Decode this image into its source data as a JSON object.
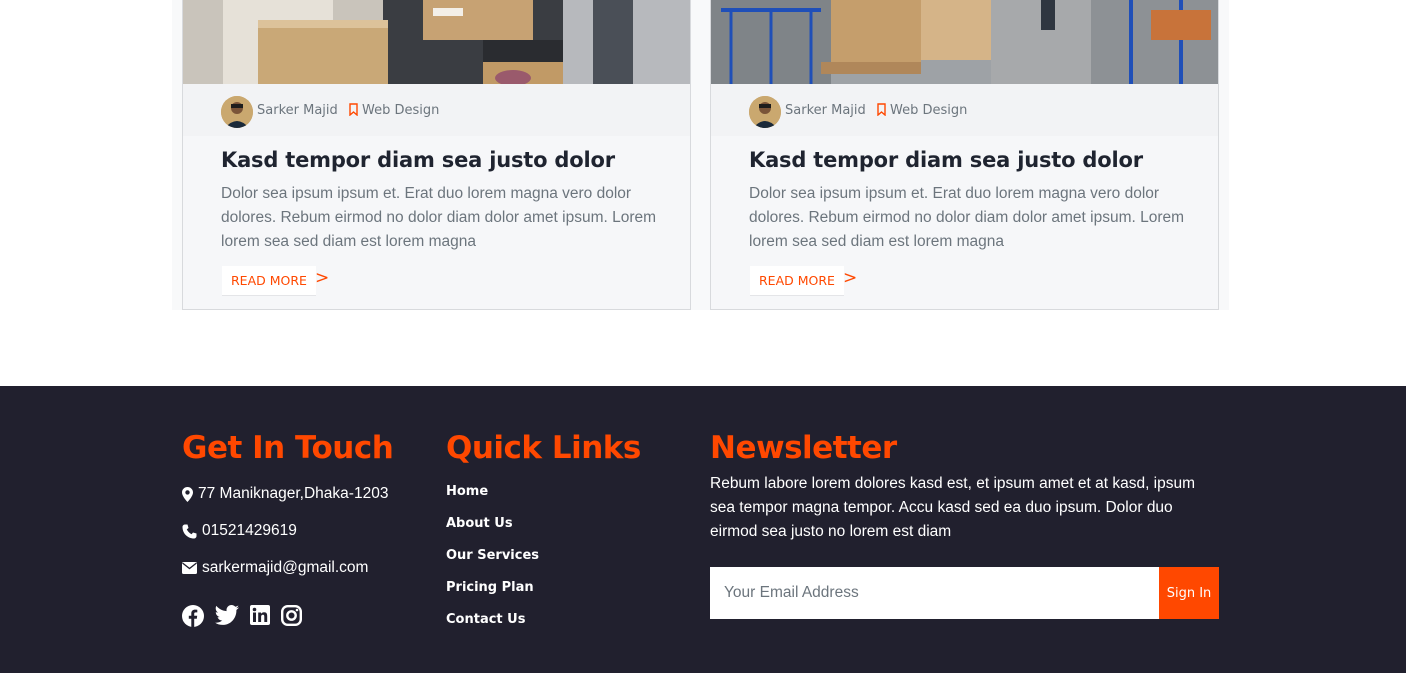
{
  "cards": [
    {
      "author": "Sarker Majid",
      "category": "Web Design",
      "title": "Kasd tempor diam sea justo dolor",
      "text": "Dolor sea ipsum ipsum et. Erat duo lorem magna vero dolor dolores. Rebum eirmod no dolor diam dolor amet ipsum. Lorem lorem sea sed diam est lorem magna",
      "read_more": "READ MORE",
      "arrow": ">"
    },
    {
      "author": "Sarker Majid",
      "category": "Web Design",
      "title": "Kasd tempor diam sea justo dolor",
      "text": "Dolor sea ipsum ipsum et. Erat duo lorem magna vero dolor dolores. Rebum eirmod no dolor diam dolor amet ipsum. Lorem lorem sea sed diam est lorem magna",
      "read_more": "READ MORE",
      "arrow": ">"
    }
  ],
  "footer": {
    "contact_heading": "Get In Touch",
    "address": "77 Maniknager,Dhaka-1203",
    "phone": "01521429619",
    "email": "sarkermajid@gmail.com",
    "social_icons": [
      "facebook-icon",
      "twitter-icon",
      "linkedin-icon",
      "instagram-icon"
    ],
    "links_heading": "Quick Links",
    "links": [
      "Home",
      "About Us",
      "Our Services",
      "Pricing Plan",
      "Contact Us"
    ],
    "newsletter_heading": "Newsletter",
    "newsletter_text": "Rebum labore lorem dolores kasd est, et ipsum amet et at kasd, ipsum sea tempor magna tempor. Accu kasd sed ea duo ipsum. Dolor duo eirmod sea justo no lorem est diam",
    "email_placeholder": "Your Email Address",
    "signin_label": "Sign In"
  },
  "colors": {
    "accent": "#FF4800",
    "footer_bg": "#21202e",
    "card_bg": "#f6f7f9"
  }
}
